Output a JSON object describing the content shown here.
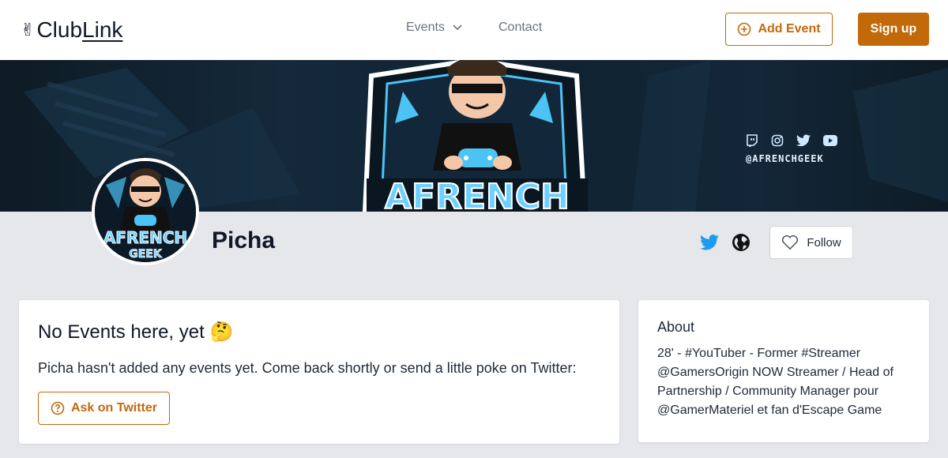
{
  "header": {
    "logo_hand": "✌",
    "logo_club": "Club",
    "logo_link": "Link",
    "nav_events": "Events",
    "nav_contact": "Contact",
    "add_event_label": "Add Event",
    "signup_label": "Sign up"
  },
  "banner": {
    "handle": "@AFRENCHGEEK",
    "mascot_text": "AFRENCH",
    "socials": [
      "twitch-icon",
      "instagram-icon",
      "twitter-icon",
      "youtube-icon"
    ]
  },
  "profile": {
    "avatar_text_top": "AFRENCH",
    "avatar_text_bottom": "GEEK",
    "name": "Picha",
    "follow_label": "Follow"
  },
  "events_card": {
    "title": "No Events here, yet 🤔",
    "text": "Picha hasn't added any events yet. Come back shortly or send a little poke on Twitter:",
    "ask_label": "Ask on Twitter"
  },
  "about_card": {
    "title": "About",
    "text": "28' - #YouTuber - Former #Streamer @GamersOrigin NOW Streamer / Head of Partnership / Community Manager pour @GamerMateriel et fan d'Escape Game"
  },
  "colors": {
    "accent": "#c2690a",
    "twitter": "#1d9bf0",
    "background": "#e5e7eb"
  }
}
